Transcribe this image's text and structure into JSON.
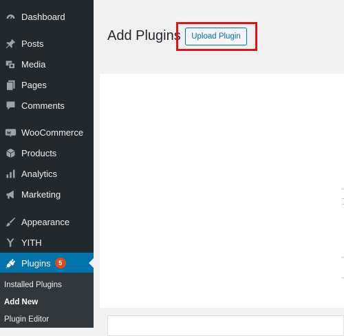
{
  "sidebar": {
    "items": [
      {
        "label": "Dashboard",
        "icon": "dashboard-icon"
      },
      {
        "label": "Posts",
        "icon": "pin-icon"
      },
      {
        "label": "Media",
        "icon": "media-icon"
      },
      {
        "label": "Pages",
        "icon": "pages-icon"
      },
      {
        "label": "Comments",
        "icon": "comment-icon"
      },
      {
        "label": "WooCommerce",
        "icon": "woocommerce-icon"
      },
      {
        "label": "Products",
        "icon": "box-icon"
      },
      {
        "label": "Analytics",
        "icon": "bar-chart-icon"
      },
      {
        "label": "Marketing",
        "icon": "megaphone-icon"
      },
      {
        "label": "Appearance",
        "icon": "paintbrush-icon"
      },
      {
        "label": "YITH",
        "icon": "yith-icon"
      },
      {
        "label": "Plugins",
        "icon": "plug-icon",
        "badge": "5",
        "active": true
      }
    ],
    "submenu": [
      {
        "label": "Installed Plugins"
      },
      {
        "label": "Add New",
        "current": true
      },
      {
        "label": "Plugin Editor"
      }
    ]
  },
  "main": {
    "title": "Add Plugins",
    "upload_button": "Upload Plugin"
  },
  "colors": {
    "sidebar_bg": "#23282d",
    "active_bg": "#0073aa",
    "badge_bg": "#d54e21",
    "highlight": "#e0131b",
    "button_text": "#0071a1"
  }
}
